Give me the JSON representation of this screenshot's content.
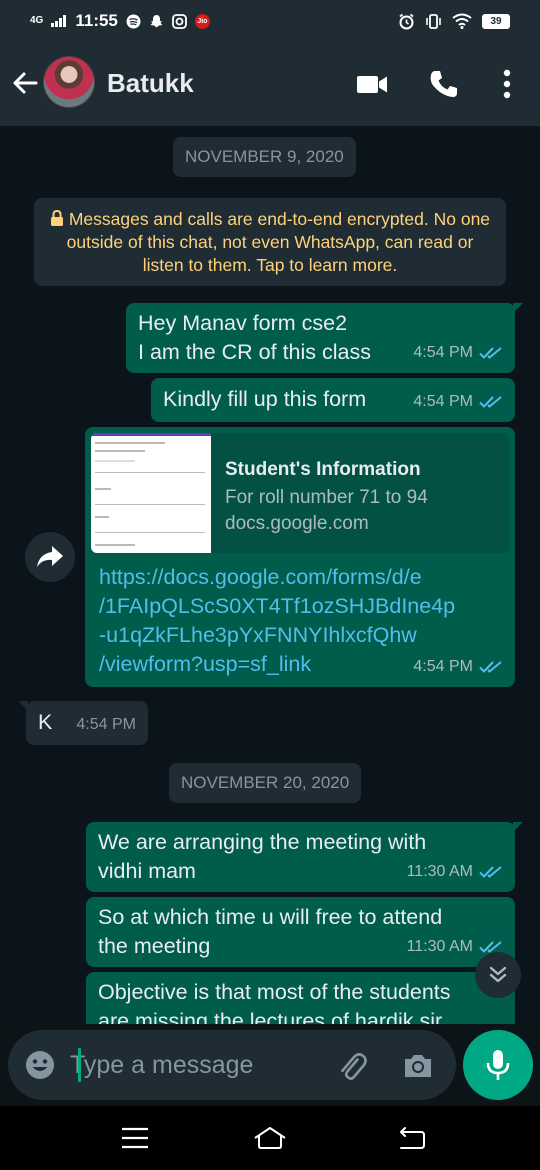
{
  "status_bar": {
    "network": "4G",
    "time": "11:55",
    "carrier": "Jio",
    "battery": "39"
  },
  "header": {
    "contact_name": "Batukk"
  },
  "chat": {
    "date_1": "NOVEMBER 9, 2020",
    "encryption_notice": "Messages and calls are end-to-end encrypted. No one outside of this chat, not even WhatsApp, can read or listen to them. Tap to learn more.",
    "messages": [
      {
        "direction": "outgoing",
        "lines": [
          "Hey Manav form cse2",
          "I am the CR of this class"
        ],
        "time": "4:54 PM",
        "status": "read"
      },
      {
        "direction": "outgoing",
        "text": "Kindly fill up this form",
        "time": "4:54 PM",
        "status": "read"
      },
      {
        "direction": "outgoing",
        "link_preview": {
          "title": "Student's Information",
          "description": "For roll number 71 to 94",
          "domain": "docs.google.com"
        },
        "link_lines": [
          "https://docs.google.com/forms/d/e",
          "/1FAIpQLScS0XT4Tf1ozSHJBdIne4p",
          "-u1qZkFLhe3pYxFNNYIhlxcfQhw",
          "/viewform?usp=sf_link"
        ],
        "time": "4:54 PM",
        "status": "read"
      },
      {
        "direction": "incoming",
        "text": "K",
        "time": "4:54 PM"
      }
    ],
    "date_2": "NOVEMBER 20, 2020",
    "messages_2": [
      {
        "direction": "outgoing",
        "lines": [
          "We are arranging the meeting with",
          "vidhi mam"
        ],
        "time": "11:30 AM",
        "status": "read"
      },
      {
        "direction": "outgoing",
        "lines": [
          "So at which time u will free to attend",
          "the meeting"
        ],
        "time": "11:30 AM",
        "status": "read"
      },
      {
        "direction": "outgoing",
        "lines": [
          "Objective is that most of the students",
          "are missing the lectures of hardik sir"
        ]
      }
    ]
  },
  "input": {
    "placeholder": "Type a message"
  },
  "colors": {
    "outgoing_bubble": "#005c4b",
    "incoming_bubble": "#1f2c33",
    "accent": "#00a884",
    "link": "#53bdeb",
    "read_ticks": "#53bdeb",
    "encryption_text": "#ffd279"
  }
}
